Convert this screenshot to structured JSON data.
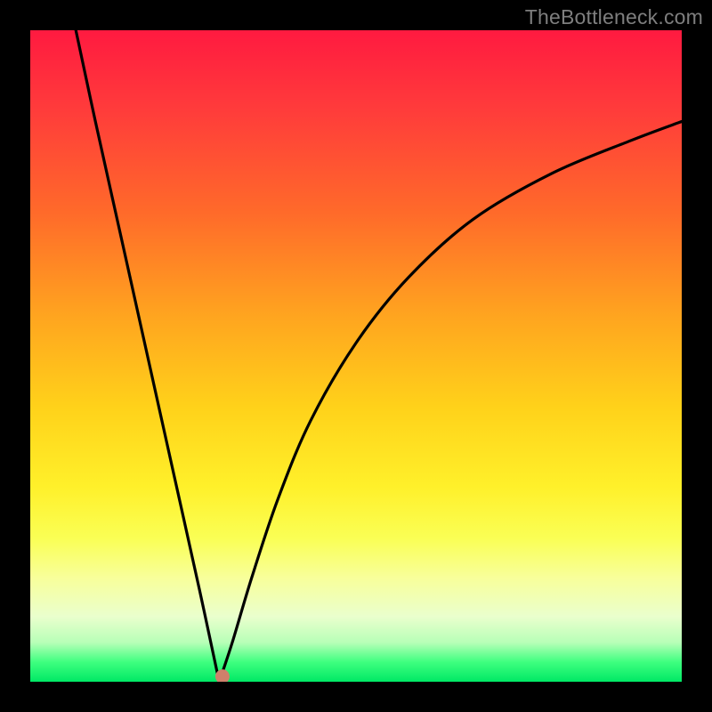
{
  "watermark": "TheBottleneck.com",
  "chart_data": {
    "type": "line",
    "title": "",
    "xlabel": "",
    "ylabel": "",
    "xlim": [
      0,
      100
    ],
    "ylim": [
      0,
      100
    ],
    "background_gradient": {
      "top": "green",
      "bottom": "red",
      "meaning": "green = optimal / low bottleneck, red = severe bottleneck"
    },
    "curve": {
      "minimum_x": 29,
      "minimum_y": 0,
      "points": [
        {
          "x": 7,
          "y": 100
        },
        {
          "x": 10,
          "y": 86
        },
        {
          "x": 14,
          "y": 68
        },
        {
          "x": 18,
          "y": 50
        },
        {
          "x": 22,
          "y": 32
        },
        {
          "x": 26,
          "y": 14
        },
        {
          "x": 29,
          "y": 0
        },
        {
          "x": 31,
          "y": 6
        },
        {
          "x": 34,
          "y": 16
        },
        {
          "x": 38,
          "y": 28
        },
        {
          "x": 43,
          "y": 40
        },
        {
          "x": 50,
          "y": 52
        },
        {
          "x": 58,
          "y": 62
        },
        {
          "x": 68,
          "y": 71
        },
        {
          "x": 80,
          "y": 78
        },
        {
          "x": 92,
          "y": 83
        },
        {
          "x": 100,
          "y": 86
        }
      ]
    },
    "marker": {
      "x": 29.5,
      "y": 0.8,
      "color": "#cf806b",
      "radius_px": 8
    }
  }
}
